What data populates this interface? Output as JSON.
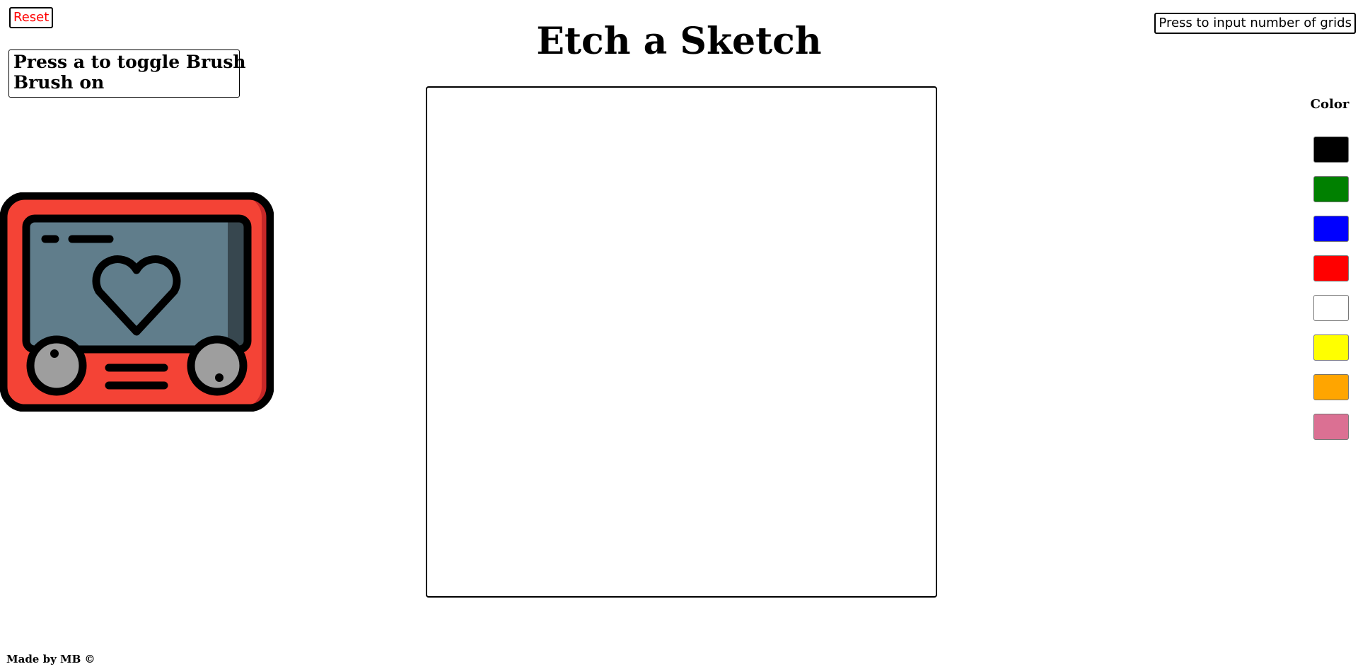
{
  "header": {
    "title": "Etch a Sketch",
    "reset_label": "Reset",
    "grid_button_label": "Press to input number of grids"
  },
  "brush": {
    "instruction": "Press a to toggle Brush",
    "status": "Brush on"
  },
  "palette": {
    "title": "Color",
    "colors": [
      "#000000",
      "#008000",
      "#0000ff",
      "#ff0000",
      "#ffffff",
      "#ffff00",
      "#ffa500",
      "#db7093"
    ]
  },
  "footer": {
    "text": "Made by MB ©"
  },
  "logo": {
    "icon": "etch-a-sketch-heart-icon",
    "colors": {
      "body": "#f44336",
      "body_shadow": "#c62828",
      "screen": "#607d8b",
      "screen_shadow": "#37474f",
      "knob": "#9e9e9e",
      "knob_shadow": "#616161",
      "outline": "#000000"
    }
  }
}
